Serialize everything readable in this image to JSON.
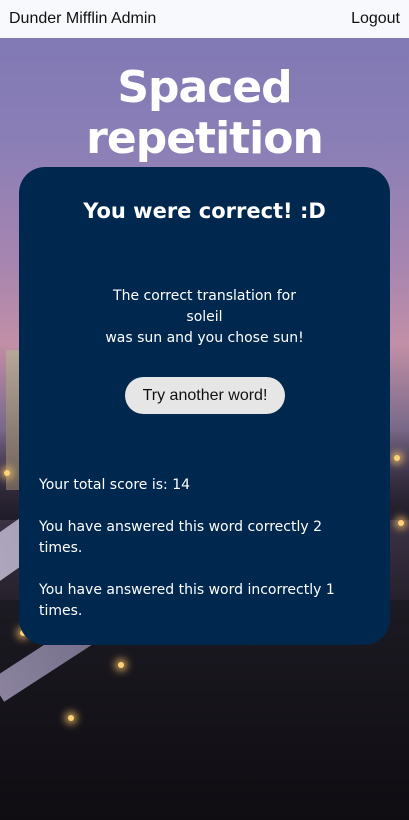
{
  "header": {
    "app_name": "Dunder Mifflin Admin",
    "logout_label": "Logout"
  },
  "page": {
    "title": "Spaced repetition"
  },
  "card": {
    "heading": "You were correct! :D",
    "feedback": {
      "line1": "The correct translation for",
      "word": "soleil",
      "line3": "was sun and you chose sun!"
    },
    "button_label": "Try another word!",
    "stats": {
      "total_score": "Your total score is: 14",
      "correct_count": "You have answered this word correctly 2 times.",
      "incorrect_count": "You have answered this word incorrectly 1 times."
    }
  },
  "colors": {
    "card_bg": "#00284f",
    "topbar_bg": "#f8f9fc",
    "button_bg": "#e6e6e6"
  }
}
